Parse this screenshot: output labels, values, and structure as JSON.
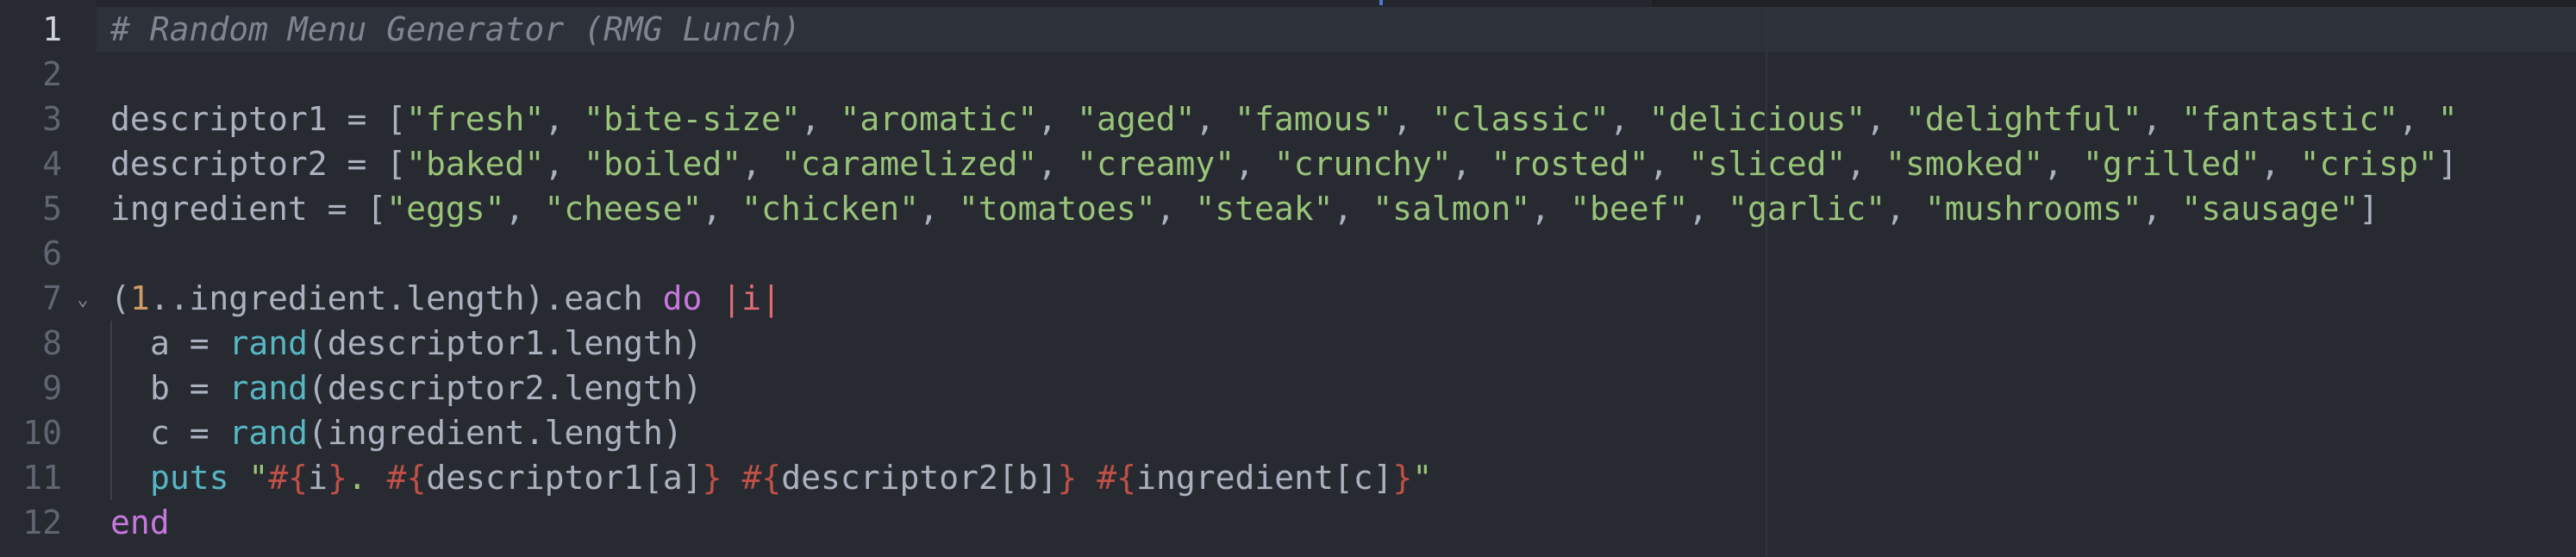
{
  "editor": {
    "gutter": {
      "line_numbers": [
        "1",
        "2",
        "3",
        "4",
        "5",
        "6",
        "7",
        "8",
        "9",
        "10",
        "11",
        "12"
      ],
      "active_line": "1"
    },
    "lines": [
      {
        "tokens": [
          {
            "type": "comment",
            "text": "# Random Menu Generator (RMG Lunch)"
          }
        ]
      },
      {
        "tokens": []
      },
      {
        "tokens": [
          {
            "type": "plain",
            "text": "descriptor1 = ["
          },
          {
            "type": "string",
            "text": "\"fresh\""
          },
          {
            "type": "plain",
            "text": ", "
          },
          {
            "type": "string",
            "text": "\"bite-size\""
          },
          {
            "type": "plain",
            "text": ", "
          },
          {
            "type": "string",
            "text": "\"aromatic\""
          },
          {
            "type": "plain",
            "text": ", "
          },
          {
            "type": "string",
            "text": "\"aged\""
          },
          {
            "type": "plain",
            "text": ", "
          },
          {
            "type": "string",
            "text": "\"famous\""
          },
          {
            "type": "plain",
            "text": ", "
          },
          {
            "type": "string",
            "text": "\"classic\""
          },
          {
            "type": "plain",
            "text": ", "
          },
          {
            "type": "string",
            "text": "\"delicious\""
          },
          {
            "type": "plain",
            "text": ", "
          },
          {
            "type": "string",
            "text": "\"delightful\""
          },
          {
            "type": "plain",
            "text": ", "
          },
          {
            "type": "string",
            "text": "\"fantastic\""
          },
          {
            "type": "plain",
            "text": ", "
          },
          {
            "type": "string",
            "text": "\""
          }
        ]
      },
      {
        "tokens": [
          {
            "type": "plain",
            "text": "descriptor2 = ["
          },
          {
            "type": "string",
            "text": "\"baked\""
          },
          {
            "type": "plain",
            "text": ", "
          },
          {
            "type": "string",
            "text": "\"boiled\""
          },
          {
            "type": "plain",
            "text": ", "
          },
          {
            "type": "string",
            "text": "\"caramelized\""
          },
          {
            "type": "plain",
            "text": ", "
          },
          {
            "type": "string",
            "text": "\"creamy\""
          },
          {
            "type": "plain",
            "text": ", "
          },
          {
            "type": "string",
            "text": "\"crunchy\""
          },
          {
            "type": "plain",
            "text": ", "
          },
          {
            "type": "string",
            "text": "\"rosted\""
          },
          {
            "type": "plain",
            "text": ", "
          },
          {
            "type": "string",
            "text": "\"sliced\""
          },
          {
            "type": "plain",
            "text": ", "
          },
          {
            "type": "string",
            "text": "\"smoked\""
          },
          {
            "type": "plain",
            "text": ", "
          },
          {
            "type": "string",
            "text": "\"grilled\""
          },
          {
            "type": "plain",
            "text": ", "
          },
          {
            "type": "string",
            "text": "\"crisp\""
          },
          {
            "type": "plain",
            "text": "]"
          }
        ]
      },
      {
        "tokens": [
          {
            "type": "plain",
            "text": "ingredient = ["
          },
          {
            "type": "string",
            "text": "\"eggs\""
          },
          {
            "type": "plain",
            "text": ", "
          },
          {
            "type": "string",
            "text": "\"cheese\""
          },
          {
            "type": "plain",
            "text": ", "
          },
          {
            "type": "string",
            "text": "\"chicken\""
          },
          {
            "type": "plain",
            "text": ", "
          },
          {
            "type": "string",
            "text": "\"tomatoes\""
          },
          {
            "type": "plain",
            "text": ", "
          },
          {
            "type": "string",
            "text": "\"steak\""
          },
          {
            "type": "plain",
            "text": ", "
          },
          {
            "type": "string",
            "text": "\"salmon\""
          },
          {
            "type": "plain",
            "text": ", "
          },
          {
            "type": "string",
            "text": "\"beef\""
          },
          {
            "type": "plain",
            "text": ", "
          },
          {
            "type": "string",
            "text": "\"garlic\""
          },
          {
            "type": "plain",
            "text": ", "
          },
          {
            "type": "string",
            "text": "\"mushrooms\""
          },
          {
            "type": "plain",
            "text": ", "
          },
          {
            "type": "string",
            "text": "\"sausage\""
          },
          {
            "type": "plain",
            "text": "]"
          }
        ]
      },
      {
        "tokens": []
      },
      {
        "tokens": [
          {
            "type": "plain",
            "text": "("
          },
          {
            "type": "number",
            "text": "1"
          },
          {
            "type": "plain",
            "text": "..ingredient.length).each "
          },
          {
            "type": "keyword",
            "text": "do"
          },
          {
            "type": "plain",
            "text": " "
          },
          {
            "type": "param",
            "text": "|i|"
          }
        ]
      },
      {
        "indent": 1,
        "tokens": [
          {
            "type": "plain",
            "text": "a = "
          },
          {
            "type": "func",
            "text": "rand"
          },
          {
            "type": "plain",
            "text": "(descriptor1.length)"
          }
        ]
      },
      {
        "indent": 1,
        "tokens": [
          {
            "type": "plain",
            "text": "b = "
          },
          {
            "type": "func",
            "text": "rand"
          },
          {
            "type": "plain",
            "text": "(descriptor2.length)"
          }
        ]
      },
      {
        "indent": 1,
        "tokens": [
          {
            "type": "plain",
            "text": "c = "
          },
          {
            "type": "func",
            "text": "rand"
          },
          {
            "type": "plain",
            "text": "(ingredient.length)"
          }
        ]
      },
      {
        "indent": 1,
        "tokens": [
          {
            "type": "func",
            "text": "puts"
          },
          {
            "type": "plain",
            "text": " "
          },
          {
            "type": "string",
            "text": "\""
          },
          {
            "type": "interp",
            "text": "#{"
          },
          {
            "type": "plain",
            "text": "i"
          },
          {
            "type": "interp",
            "text": "}"
          },
          {
            "type": "string",
            "text": ". "
          },
          {
            "type": "interp",
            "text": "#{"
          },
          {
            "type": "plain",
            "text": "descriptor1[a]"
          },
          {
            "type": "interp",
            "text": "}"
          },
          {
            "type": "string",
            "text": " "
          },
          {
            "type": "interp",
            "text": "#{"
          },
          {
            "type": "plain",
            "text": "descriptor2[b]"
          },
          {
            "type": "interp",
            "text": "}"
          },
          {
            "type": "string",
            "text": " "
          },
          {
            "type": "interp",
            "text": "#{"
          },
          {
            "type": "plain",
            "text": "ingredient[c]"
          },
          {
            "type": "interp",
            "text": "}"
          },
          {
            "type": "string",
            "text": "\""
          }
        ]
      },
      {
        "tokens": [
          {
            "type": "keyword",
            "text": "end"
          }
        ]
      }
    ],
    "fold_icon": "chevron-down-icon",
    "colors": {
      "background": "#272a31",
      "comment": "#7f848e",
      "plain": "#abb2bf",
      "string": "#98c379",
      "keyword": "#c678dd",
      "number": "#d19a66",
      "function": "#56b6c2",
      "interpolation": "#be5046",
      "parameter": "#e06c75"
    }
  }
}
